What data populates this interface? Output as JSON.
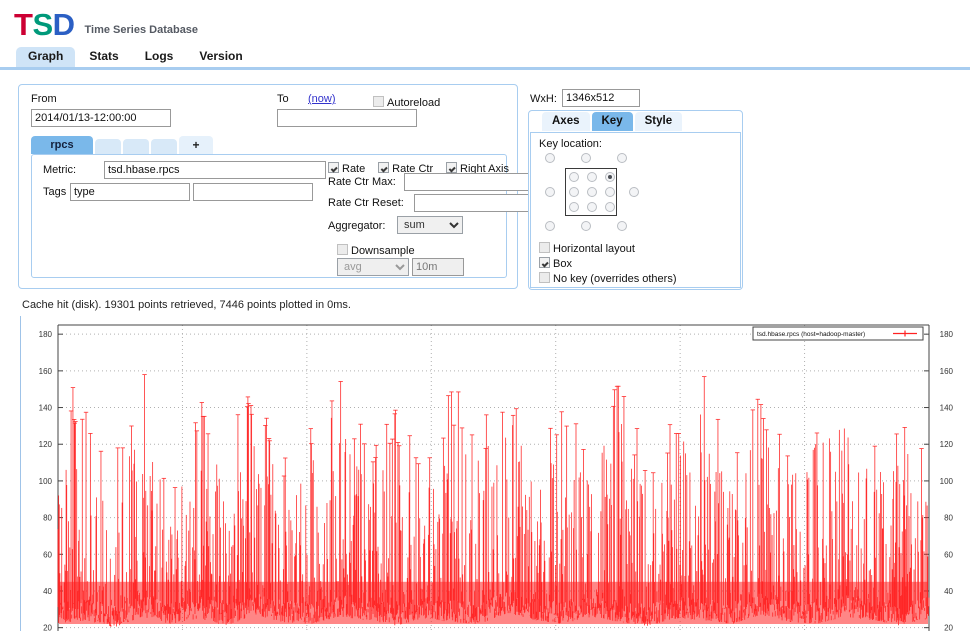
{
  "app": {
    "logo": {
      "l1": "T",
      "l2": "S",
      "l3": "D"
    },
    "subtitle": "Time Series Database"
  },
  "main_tabs": [
    {
      "label": "Graph",
      "active": true
    },
    {
      "label": "Stats",
      "active": false
    },
    {
      "label": "Logs",
      "active": false
    },
    {
      "label": "Version",
      "active": false
    }
  ],
  "query": {
    "from_label": "From",
    "from_value": "2014/01/13-12:00:00",
    "to_label": "To",
    "now_link": "(now)",
    "to_value": "",
    "autoreload_label": "Autoreload",
    "autoreload_checked": false,
    "metric_tabs": [
      {
        "label": "rpcs",
        "active": true
      },
      {
        "label": "",
        "active": false
      },
      {
        "label": "",
        "active": false
      },
      {
        "label": "",
        "active": false
      }
    ],
    "add_tab_label": "+",
    "metric_label": "Metric:",
    "metric_value": "tsd.hbase.rpcs",
    "tags_label": "Tags",
    "tag_key": "type",
    "tag_value": "",
    "rate_label": "Rate",
    "rate_checked": true,
    "rate_ctr_label": "Rate Ctr",
    "rate_ctr_checked": true,
    "right_axis_label": "Right Axis",
    "right_axis_checked": true,
    "rate_ctr_max_label": "Rate Ctr Max:",
    "rate_ctr_max_value": "",
    "rate_ctr_reset_label": "Rate Ctr Reset:",
    "rate_ctr_reset_value": "",
    "aggregator_label": "Aggregator:",
    "aggregator_value": "sum",
    "downsample_label": "Downsample",
    "downsample_checked": false,
    "downsample_fn": "avg",
    "downsample_interval": "10m"
  },
  "options": {
    "wxh_label": "WxH:",
    "wxh_value": "1346x512",
    "tabs": [
      {
        "label": "Axes",
        "active": false
      },
      {
        "label": "Key",
        "active": true
      },
      {
        "label": "Style",
        "active": false
      }
    ],
    "key_location_label": "Key location:",
    "key_selected_index": 5,
    "horizontal_layout_label": "Horizontal layout",
    "horizontal_layout_checked": false,
    "box_label": "Box",
    "box_checked": true,
    "no_key_label": "No key (overrides others)",
    "no_key_checked": false
  },
  "status": {
    "text": "Cache hit (disk). 19301 points retrieved, 7446 points plotted in 0ms."
  },
  "chart_data": {
    "type": "line",
    "title": "",
    "xlabel": "",
    "ylabel": "",
    "legend": [
      "tsd.hbase.rpcs (host=hadoop-master)"
    ],
    "legend_position": "top-right",
    "series_color": "#ff2222",
    "grid": true,
    "left_axis": {
      "ticks": [
        180,
        160,
        140,
        120,
        100,
        80,
        60,
        40,
        20
      ],
      "ylim": [
        10,
        185
      ]
    },
    "right_axis": {
      "ticks": [
        180,
        160,
        140,
        120,
        100,
        80,
        60,
        40,
        20
      ],
      "ylim": [
        10,
        185
      ]
    },
    "description": "Dense spiky red time-series of RPC rate, values mostly 20-130 with frequent spikes reaching 150-180.",
    "envelope": [
      {
        "x": 0,
        "lo": 22,
        "hi": 172
      },
      {
        "x": 1,
        "lo": 24,
        "hi": 140
      },
      {
        "x": 2,
        "lo": 20,
        "hi": 118
      },
      {
        "x": 3,
        "lo": 26,
        "hi": 163
      },
      {
        "x": 4,
        "lo": 22,
        "hi": 100
      },
      {
        "x": 5,
        "lo": 25,
        "hi": 150
      },
      {
        "x": 6,
        "lo": 21,
        "hi": 128
      },
      {
        "x": 7,
        "lo": 27,
        "hi": 158
      },
      {
        "x": 8,
        "lo": 23,
        "hi": 112
      },
      {
        "x": 9,
        "lo": 22,
        "hi": 135
      },
      {
        "x": 10,
        "lo": 26,
        "hi": 168
      },
      {
        "x": 11,
        "lo": 24,
        "hi": 120
      },
      {
        "x": 12,
        "lo": 21,
        "hi": 144
      },
      {
        "x": 13,
        "lo": 25,
        "hi": 108
      },
      {
        "x": 14,
        "lo": 23,
        "hi": 155
      },
      {
        "x": 15,
        "lo": 22,
        "hi": 130
      },
      {
        "x": 16,
        "lo": 28,
        "hi": 162
      },
      {
        "x": 17,
        "lo": 24,
        "hi": 115
      },
      {
        "x": 18,
        "lo": 22,
        "hi": 148
      },
      {
        "x": 19,
        "lo": 26,
        "hi": 125
      },
      {
        "x": 20,
        "lo": 23,
        "hi": 158
      },
      {
        "x": 21,
        "lo": 21,
        "hi": 110
      },
      {
        "x": 22,
        "lo": 25,
        "hi": 140
      },
      {
        "x": 23,
        "lo": 24,
        "hi": 165
      },
      {
        "x": 24,
        "lo": 22,
        "hi": 122
      },
      {
        "x": 25,
        "lo": 27,
        "hi": 152
      },
      {
        "x": 26,
        "lo": 23,
        "hi": 118
      },
      {
        "x": 27,
        "lo": 22,
        "hi": 145
      },
      {
        "x": 28,
        "lo": 26,
        "hi": 160
      },
      {
        "x": 29,
        "lo": 24,
        "hi": 128
      },
      {
        "x": 30,
        "lo": 21,
        "hi": 150
      },
      {
        "x": 31,
        "lo": 25,
        "hi": 112
      }
    ]
  }
}
